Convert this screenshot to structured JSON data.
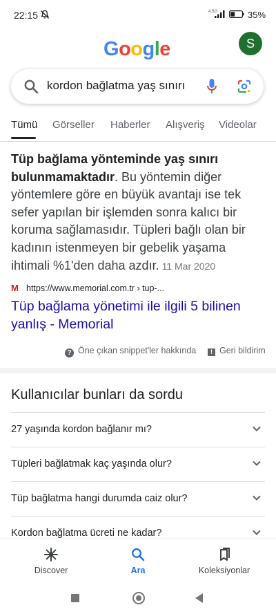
{
  "status_bar": {
    "time": "22:15",
    "network": "4.5G",
    "battery_pct": "35%"
  },
  "header": {
    "logo_text": "Google",
    "avatar_letter": "S"
  },
  "search": {
    "query": "kordon bağlatma yaş sınırı"
  },
  "tabs": [
    {
      "label": "Tümü",
      "active": true
    },
    {
      "label": "Görseller"
    },
    {
      "label": "Haberler"
    },
    {
      "label": "Alışveriş"
    },
    {
      "label": "Videolar"
    }
  ],
  "snippet": {
    "bold_text": "Tüp bağlama yönteminde yaş sınırı bulunmamaktadır",
    "body_text": ". Bu yöntemin diğer yöntemlere göre en büyük avantajı ise tek sefer yapılan bir işlemden sonra kalıcı bir koruma sağlamasıdır. Tüpleri bağlı olan bir kadının istenmeyen bir gebelik yaşama ihtimali %1'den daha azdır.",
    "date": "11 Mar 2020",
    "source_url": "https://www.memorial.com.tr › tup-...",
    "source_letter": "M",
    "link_title": "Tüp bağlama yönetimi ile ilgili 5 bilinen yanlış - Memorial",
    "about_label": "Öne çıkan snippet'ler hakkında",
    "feedback_label": "Geri bildirim"
  },
  "people_also_ask": {
    "title": "Kullanıcılar bunları da sordu",
    "questions": [
      "27 yaşında kordon bağlanır mı?",
      "Tüpleri bağlatmak kaç yaşında olur?",
      "Tüp bağlatma hangi durumda caiz olur?",
      "Kordon bağlatma ücreti ne kadar?"
    ]
  },
  "bottom_nav": [
    {
      "label": "Discover",
      "icon": "asterisk-icon"
    },
    {
      "label": "Ara",
      "icon": "search-icon",
      "active": true
    },
    {
      "label": "Koleksiyonlar",
      "icon": "bookmarks-icon"
    }
  ],
  "colors": {
    "link": "#1a0dab",
    "accent": "#1a73e8",
    "avatar": "#1e6f30"
  }
}
